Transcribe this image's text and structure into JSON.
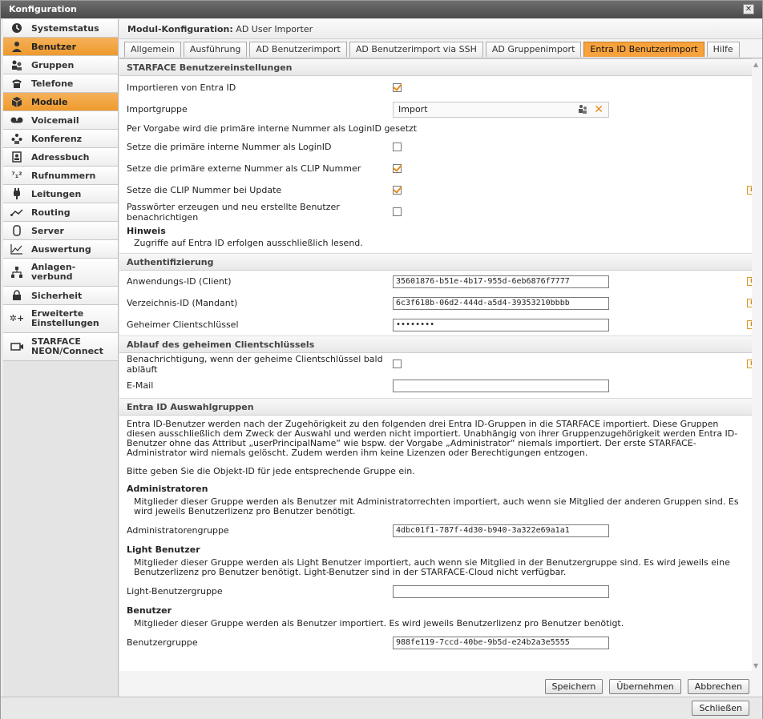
{
  "window": {
    "title": "Konfiguration",
    "close_glyph": "✕"
  },
  "sidebar": {
    "items": [
      {
        "label": "Systemstatus",
        "icon": "clock-icon"
      },
      {
        "label": "Benutzer",
        "icon": "user-icon"
      },
      {
        "label": "Gruppen",
        "icon": "group-icon"
      },
      {
        "label": "Telefone",
        "icon": "phone-icon"
      },
      {
        "label": "Module",
        "icon": "module-icon"
      },
      {
        "label": "Voicemail",
        "icon": "voicemail-icon"
      },
      {
        "label": "Konferenz",
        "icon": "conference-icon"
      },
      {
        "label": "Adressbuch",
        "icon": "addressbook-icon"
      },
      {
        "label": "Rufnummern",
        "icon": "numbers-icon"
      },
      {
        "label": "Leitungen",
        "icon": "line-icon"
      },
      {
        "label": "Routing",
        "icon": "routing-icon"
      },
      {
        "label": "Server",
        "icon": "server-icon"
      },
      {
        "label": "Auswertung",
        "icon": "chart-icon"
      },
      {
        "label_line1": "Anlagen-",
        "label_line2": "verbund",
        "icon": "network-icon"
      },
      {
        "label": "Sicherheit",
        "icon": "lock-icon"
      },
      {
        "label_line1": "Erweiterte",
        "label_line2": "Einstellungen",
        "icon": "settings-icon"
      },
      {
        "label_line1": "STARFACE",
        "label_line2": "NEON/Connect",
        "icon": "camera-icon"
      }
    ]
  },
  "module": {
    "header_label": "Modul-Konfiguration:",
    "header_value": "AD User Importer"
  },
  "tabs": [
    {
      "label": "Allgemein"
    },
    {
      "label": "Ausführung"
    },
    {
      "label": "AD Benutzerimport"
    },
    {
      "label": "AD Benutzerimport via SSH"
    },
    {
      "label": "AD Gruppenimport"
    },
    {
      "label": "Entra ID Benutzerimport"
    },
    {
      "label": "Hilfe"
    }
  ],
  "settings": {
    "title": "STARFACE Benutzereinstellungen",
    "import_entra": "Importieren von Entra ID",
    "import_group_label": "Importgruppe",
    "import_group_value": "Import",
    "default_note": "Per Vorgabe wird die primäre interne Nummer als LoginID gesetzt",
    "set_internal": "Setze die primäre interne Nummer als LoginID",
    "set_external": "Setze die primäre externe Nummer als CLIP Nummer",
    "set_clip_update": "Setze die CLIP Nummer bei Update",
    "passwords": "Passwörter erzeugen und neu erstellte Benutzer benachrichtigen",
    "hint_title": "Hinweis",
    "hint_text": "Zugriffe auf Entra ID erfolgen ausschließlich lesend."
  },
  "auth": {
    "title": "Authentifizierung",
    "app_id_label": "Anwendungs-ID (Client)",
    "app_id_value": "35601876-b51e-4b17-955d-6eb6876f7777",
    "tenant_label": "Verzeichnis-ID (Mandant)",
    "tenant_value": "6c3f618b-06d2-444d-a5d4-39353210bbbb",
    "secret_label": "Geheimer Clientschlüssel",
    "secret_value": "••••••••"
  },
  "expiry": {
    "title": "Ablauf des geheimen Clientschlüssels",
    "notify_label": "Benachrichtigung, wenn der geheime Clientschlüssel bald abläuft",
    "email_label": "E-Mail",
    "email_value": ""
  },
  "groups": {
    "title": "Entra ID Auswahlgruppen",
    "intro": "Entra ID-Benutzer werden nach der Zugehörigkeit zu den folgenden drei Entra ID-Gruppen in die STARFACE importiert. Diese Gruppen diesen ausschließlich dem Zweck der Auswahl und werden nicht importiert. Unabhängig von ihrer Gruppenzugehörigkeit werden Entra ID-Benutzer ohne das Attribut „userPrincipalName“ wie bspw. der Vorgabe „Administrator“ niemals importiert. Der erste STARFACE-Administrator wird niemals gelöscht. Zudem werden ihm keine Lizenzen oder Berechtigungen entzogen.",
    "enter_ids": "Bitte geben Sie die Objekt-ID für jede entsprechende Gruppe ein.",
    "admin_title": "Administratoren",
    "admin_desc": "Mitglieder dieser Gruppe werden als Benutzer mit Administratorrechten importiert, auch wenn sie Mitglied der anderen Gruppen sind. Es wird jeweils Benutzerlizenz pro Benutzer benötigt.",
    "admin_label": "Administratorengruppe",
    "admin_value": "4dbc01f1-787f-4d30-b940-3a322e69a1a1",
    "light_title": "Light Benutzer",
    "light_desc": "Mitglieder dieser Gruppe werden als Light Benutzer importiert, auch wenn sie Mitglied in der Benutzergruppe sind. Es wird jeweils eine Benutzerlizenz pro Benutzer benötigt. Light-Benutzer sind in der STARFACE-Cloud nicht verfügbar.",
    "light_label": "Light-Benutzergruppe",
    "light_value": "",
    "user_title": "Benutzer",
    "user_desc": "Mitglieder dieser Gruppe werden als Benutzer importiert. Es wird jeweils Benutzerlizenz pro Benutzer benötigt.",
    "user_label": "Benutzergruppe",
    "user_value": "988fe119-7ccd-40be-9b5d-e24b2a3e5555"
  },
  "buttons": {
    "save": "Speichern",
    "apply": "Übernehmen",
    "cancel": "Abbrechen",
    "close": "Schließen"
  },
  "info_glyph": "i"
}
